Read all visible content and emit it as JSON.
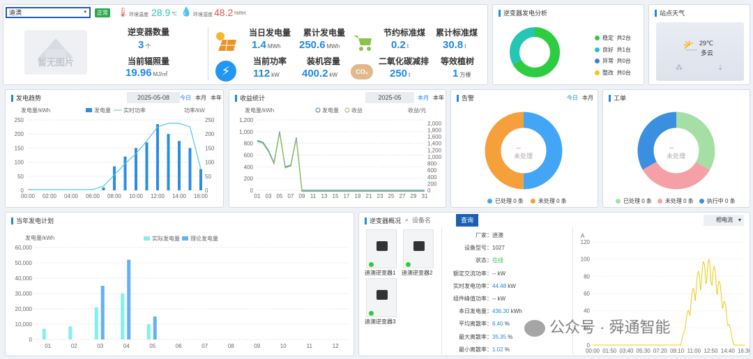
{
  "header": {
    "site_select": "迪澳",
    "status_badge": "正常",
    "temp_label": "环境温度",
    "temp_value": "28.9",
    "temp_unit": "℃",
    "hum_label": "环境湿度",
    "hum_value": "48.2",
    "hum_unit": "%RH",
    "no_image": "暂无图片"
  },
  "kpis": {
    "inverter_count_label": "逆变器数量",
    "inverter_count": "3",
    "inverter_count_unit": "个",
    "irradiance_label": "当前辐照量",
    "irradiance": "19.96",
    "irradiance_unit": "MJ/㎡",
    "daily_gen_label": "当日发电量",
    "daily_gen": "1.4",
    "daily_gen_unit": "MWh",
    "total_gen_label": "累计发电量",
    "total_gen": "250.6",
    "total_gen_unit": "MWh",
    "power_label": "当前功率",
    "power": "112",
    "power_unit": "kW",
    "capacity_label": "装机容量",
    "capacity": "400.2",
    "capacity_unit": "kW",
    "coal_label": "节约标准煤",
    "coal": "0.2",
    "coal_unit": "t",
    "total_coal_label": "累计标准煤",
    "total_coal": "30.8",
    "total_coal_unit": "t",
    "co2_label": "二氧化碳减排",
    "co2": "250",
    "co2_unit": "t",
    "trees_label": "等效植树",
    "trees": "1",
    "trees_unit": "万棵",
    "co2_icon": "CO₂"
  },
  "analysis": {
    "title": "逆变器发电分析",
    "items": [
      {
        "label": "稳定",
        "count": "共2台",
        "color": "#2ecc40"
      },
      {
        "label": "良好",
        "count": "共1台",
        "color": "#26c6b5"
      },
      {
        "label": "异常",
        "count": "共0台",
        "color": "#3b7be8"
      },
      {
        "label": "整改",
        "count": "共0台",
        "color": "#f2c811"
      }
    ],
    "values": [
      2,
      1,
      0,
      0
    ]
  },
  "weather": {
    "title": "站点天气",
    "temp": "29℃",
    "desc": "多云"
  },
  "trend": {
    "title": "发电趋势",
    "date": "2025-05-08",
    "tab_day": "今日",
    "tab_month": "本月",
    "tab_year": "本年",
    "y1": "发电量/kWh",
    "y2": "功率/kW",
    "legend_energy": "发电量",
    "legend_power": "实时功率"
  },
  "revenue": {
    "title": "收益统计",
    "date": "2025-05",
    "tab_month": "本月",
    "tab_year": "本年",
    "y1": "发电量/kWh",
    "y2": "收益/元",
    "legend_energy": "发电量",
    "legend_income": "收益"
  },
  "alarm": {
    "title": "告警",
    "tab_day": "今日",
    "tab_month": "本月",
    "center_dash": "--",
    "center_label": "未处理",
    "legend": [
      {
        "label": "已处理 0 条",
        "color": "#42a5f5"
      },
      {
        "label": "未处理 0 条",
        "color": "#f5a03a"
      }
    ]
  },
  "workorder": {
    "title": "工单",
    "center_dash": "--",
    "center_label": "未处理",
    "legend": [
      {
        "label": "已处理 0 条",
        "color": "#a5dfa5"
      },
      {
        "label": "未处理 0 条",
        "color": "#f5a0a6"
      },
      {
        "label": "执行中 0 条",
        "color": "#3b8fe0"
      }
    ]
  },
  "plan": {
    "title": "当年发电计划",
    "ylabel": "发电量/kWh",
    "legend_actual": "实际发电量",
    "legend_theory": "理论发电量"
  },
  "overview": {
    "title": "逆变器概况",
    "search_placeholder": "设备名",
    "query_button": "查询",
    "phase_select": "相电流",
    "inverters": [
      "迪澳逆变器1",
      "迪澳逆变器2",
      "迪澳逆变器3"
    ],
    "fields": [
      {
        "k": "厂家",
        "v": "迪澳",
        "u": "",
        "c": "#444"
      },
      {
        "k": "设备型号",
        "v": "1027",
        "u": "",
        "c": "#444"
      },
      {
        "k": "状态",
        "v": "在线",
        "u": "",
        "c": "#2ecc40"
      },
      {
        "k": "额定交流功率",
        "v": "--",
        "u": "kW",
        "c": "#444"
      },
      {
        "k": "实时发电功率",
        "v": "44.48",
        "u": "kW",
        "c": "#1e88e5"
      },
      {
        "k": "组件峰值功率",
        "v": "--",
        "u": "kW",
        "c": "#444"
      },
      {
        "k": "本日发电量",
        "v": "436.30",
        "u": "kWh",
        "c": "#1e88e5"
      },
      {
        "k": "平均离散率",
        "v": "6.40",
        "u": "%",
        "c": "#1e88e5"
      },
      {
        "k": "最大离散率",
        "v": "35.35",
        "u": "%",
        "c": "#1e88e5"
      },
      {
        "k": "最小离散率",
        "v": "1.02",
        "u": "%",
        "c": "#1e88e5"
      }
    ],
    "legend_a": "A相电流",
    "legend_b": "B相电流",
    "legend_c": "C相电流",
    "ylabel": "A"
  },
  "watermark": "公众号 · 舜通智能",
  "chart_data": [
    {
      "id": "trend",
      "type": "bar",
      "x": [
        "00:00",
        "01:00",
        "02:00",
        "03:00",
        "04:00",
        "05:00",
        "06:00",
        "07:00",
        "08:00",
        "09:00",
        "10:00",
        "11:00",
        "12:00",
        "13:00",
        "14:00",
        "15:00",
        "16:00"
      ],
      "series": [
        {
          "name": "发电量",
          "type": "bar",
          "values": [
            0,
            0,
            0,
            0,
            0,
            0,
            0,
            10,
            85,
            120,
            150,
            170,
            235,
            200,
            175,
            150,
            75
          ]
        },
        {
          "name": "实时功率",
          "type": "line",
          "values": [
            3,
            3,
            3,
            3,
            3,
            3,
            3,
            15,
            55,
            95,
            130,
            175,
            225,
            238,
            238,
            225,
            75
          ]
        }
      ],
      "ylim": [
        0,
        250
      ]
    },
    {
      "id": "revenue",
      "type": "line",
      "x": [
        "01",
        "02",
        "03",
        "04",
        "05",
        "06",
        "07",
        "08",
        "09",
        "10",
        "11",
        "12",
        "13",
        "14",
        "15",
        "16",
        "17",
        "18",
        "19",
        "20",
        "21",
        "22",
        "23",
        "24",
        "25",
        "26",
        "27",
        "28",
        "29",
        "30",
        "31"
      ],
      "series": [
        {
          "name": "发电量",
          "values": [
            850,
            820,
            680,
            470,
            1000,
            400,
            430,
            900,
            0,
            0,
            0,
            0,
            0,
            0,
            0,
            0,
            0,
            0,
            0,
            0,
            0,
            0,
            0,
            0,
            0,
            0,
            0,
            0,
            0,
            0,
            0
          ]
        },
        {
          "name": "收益",
          "values": [
            850,
            820,
            680,
            470,
            1000,
            400,
            430,
            900,
            0,
            0,
            0,
            0,
            0,
            0,
            0,
            0,
            0,
            0,
            0,
            0,
            0,
            0,
            0,
            0,
            0,
            0,
            0,
            0,
            0,
            0,
            0
          ]
        }
      ],
      "ylim": [
        0,
        1200
      ],
      "y2lim": [
        0,
        2100
      ]
    },
    {
      "id": "plan",
      "type": "bar",
      "categories": [
        "01",
        "02",
        "03",
        "04",
        "05",
        "06",
        "07",
        "08",
        "09",
        "10",
        "11",
        "12"
      ],
      "series": [
        {
          "name": "实际发电量",
          "values": [
            7000,
            8500,
            21000,
            30000,
            10000,
            0,
            0,
            0,
            0,
            0,
            0,
            0
          ]
        },
        {
          "name": "理论发电量",
          "values": [
            0,
            0,
            35000,
            52000,
            15000,
            0,
            0,
            0,
            0,
            0,
            0,
            0
          ]
        }
      ],
      "ylim": [
        0,
        60000
      ]
    },
    {
      "id": "phase",
      "type": "line",
      "x": [
        "00:00",
        "01:50",
        "03:40",
        "05:30",
        "07:20",
        "09:10",
        "11:00",
        "12:50",
        "14:40",
        "16:30"
      ],
      "ylim": [
        0,
        120
      ]
    }
  ]
}
